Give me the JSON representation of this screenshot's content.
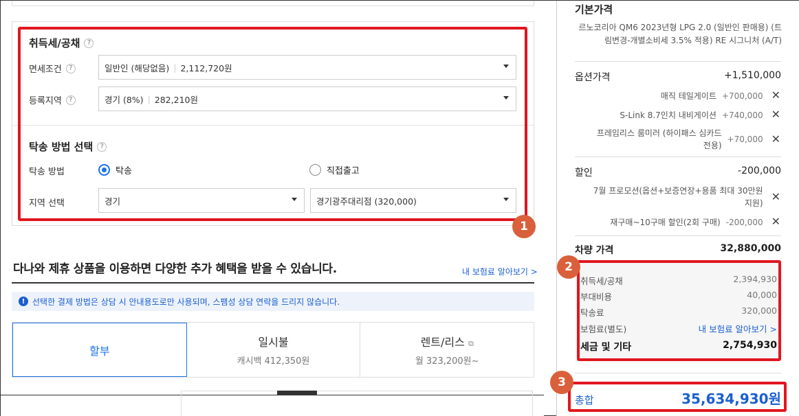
{
  "left": {
    "acquisition": {
      "title": "취득세/공채",
      "help": "?",
      "tax_exempt_label": "면세조건",
      "tax_exempt_value": "일반인 (해당없음)",
      "tax_exempt_amount": "2,112,720원",
      "region_label": "등록지역",
      "region_value": "경기 (8%)",
      "region_amount": "282,210원"
    },
    "delivery": {
      "title": "탁송 방법 선택",
      "method_label": "탁송 방법",
      "option_delivery": "탁송",
      "option_pickup": "직접출고",
      "selected": "탁송",
      "area_label": "지역 선택",
      "area_value": "경기",
      "branch_value": "경기광주대리점 (320,000)"
    },
    "badge1": "1",
    "promo_title": "다나와 제휴 상품을 이용하면 다양한 추가 혜택을 받을 수 있습니다.",
    "insurance_link": "내 보험료 알아보기 >",
    "notice_icon": "!",
    "notice": "선택한 결제 방법은 상담 시 안내용도로만 사용되며, 스팸성 상담 연락을 드리지 않습니다.",
    "payment_tabs": [
      {
        "title": "할부",
        "sub": ""
      },
      {
        "title": "일시불",
        "sub": "캐시백 412,350원"
      },
      {
        "title": "렌트/리스",
        "sub": "월 323,200원~"
      }
    ],
    "copy_icon": "⧉"
  },
  "right": {
    "base_title": "기본가격",
    "base_desc": "르노코리아 QM6 2023년형 LPG 2.0 (일반인 판매용) (트림변경-개별소비세 3.5% 적용) RE 시그니처 (A/T)",
    "option_label": "옵션가격",
    "option_value": "+1,510,000",
    "options": [
      {
        "name": "매직 테일게이트",
        "value": "+700,000"
      },
      {
        "name": "S-Link 8.7인치 내비게이션",
        "value": "+740,000"
      },
      {
        "name": "프레임리스 룸미러 (하이패스 심카드 전용)",
        "value": "+70,000"
      }
    ],
    "discount_label": "할인",
    "discount_value": "-200,000",
    "discounts": [
      {
        "name": "7월 프로모션(옵션+보증연장+용품 최대 30만원 지원)",
        "value": ""
      },
      {
        "name": "재구매~10구매 할인(2회 구매)",
        "value": "-200,000"
      }
    ],
    "close_glyph": "✕",
    "vehicle_label": "차량 가격",
    "vehicle_value": "32,880,000",
    "badge2": "2",
    "fees": [
      {
        "name": "취득세/공채",
        "value": "2,394,930"
      },
      {
        "name": "부대비용",
        "value": "40,000"
      },
      {
        "name": "탁송료",
        "value": "320,000"
      }
    ],
    "insurance_label": "보험료(별도)",
    "insurance_link": "내 보험료 알아보기 >",
    "tax_total_label": "세금 및 기타",
    "tax_total_value": "2,754,930",
    "badge3": "3",
    "total_label": "총합",
    "total_value": "35,634,930원"
  },
  "colors": {
    "accent": "#1a73e8",
    "highlight": "#e0161f",
    "badge": "#d9603b"
  }
}
